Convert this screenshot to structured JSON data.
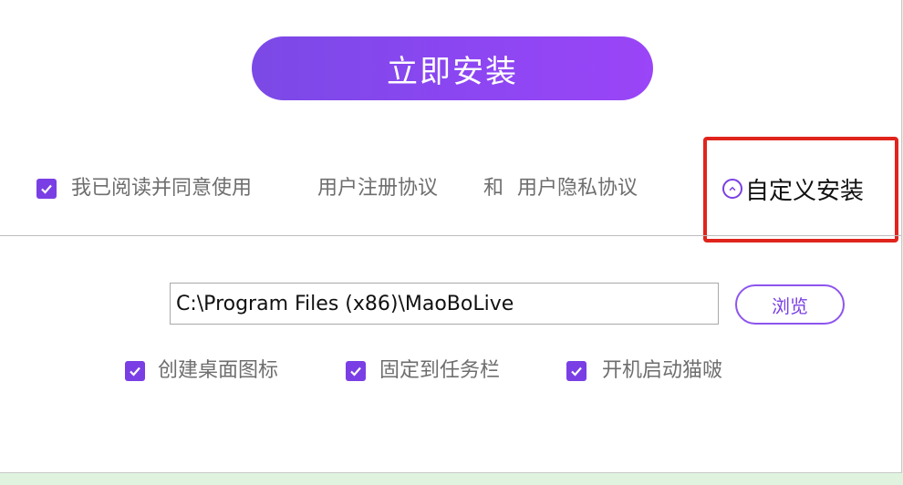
{
  "install_button": {
    "label": "立即安装"
  },
  "agreement": {
    "checked": true,
    "prefix": "我已阅读并同意使用",
    "user_agreement": "用户注册协议",
    "and": "和",
    "privacy_policy": "用户隐私协议"
  },
  "custom_install": {
    "label": "自定义安装",
    "icon": "chevron-up-circle-icon"
  },
  "install_path": {
    "value": "C:\\Program Files (x86)\\MaoBoLive"
  },
  "browse_button": {
    "label": "浏览"
  },
  "options": [
    {
      "label": "创建桌面图标",
      "checked": true
    },
    {
      "label": "固定到任务栏",
      "checked": true
    },
    {
      "label": "开机启动猫啵",
      "checked": true
    }
  ],
  "colors": {
    "accent": "#7a3fe4",
    "highlight": "#e0241c",
    "page_background": "#dff3df"
  }
}
